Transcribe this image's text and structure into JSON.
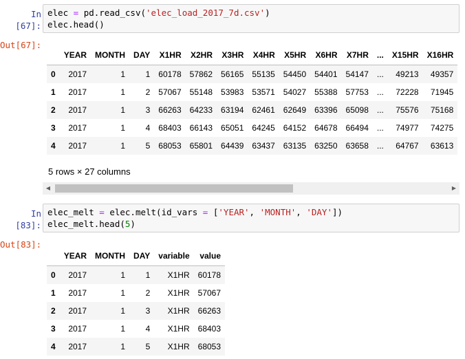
{
  "cell1": {
    "in_prompt": "In [67]:",
    "out_prompt": "Out[67]:",
    "code_line1_a": "elec ",
    "code_line1_op": "=",
    "code_line1_b": " pd.read_csv(",
    "code_line1_str": "'elec_load_2017_7d.csv'",
    "code_line1_c": ")",
    "code_line2": "elec.head()"
  },
  "df1": {
    "columns": [
      "",
      "YEAR",
      "MONTH",
      "DAY",
      "X1HR",
      "X2HR",
      "X3HR",
      "X4HR",
      "X5HR",
      "X6HR",
      "X7HR",
      "...",
      "X15HR",
      "X16HR"
    ],
    "rows": [
      [
        "0",
        "2017",
        "1",
        "1",
        "60178",
        "57862",
        "56165",
        "55135",
        "54450",
        "54401",
        "54147",
        "...",
        "49213",
        "49357"
      ],
      [
        "1",
        "2017",
        "1",
        "2",
        "57067",
        "55148",
        "53983",
        "53571",
        "54027",
        "55388",
        "57753",
        "...",
        "72228",
        "71945"
      ],
      [
        "2",
        "2017",
        "1",
        "3",
        "66263",
        "64233",
        "63194",
        "62461",
        "62649",
        "63396",
        "65098",
        "...",
        "75576",
        "75168"
      ],
      [
        "3",
        "2017",
        "1",
        "4",
        "68403",
        "66143",
        "65051",
        "64245",
        "64152",
        "64678",
        "66494",
        "...",
        "74977",
        "74275"
      ],
      [
        "4",
        "2017",
        "1",
        "5",
        "68053",
        "65801",
        "64439",
        "63437",
        "63135",
        "63250",
        "63658",
        "...",
        "64767",
        "63613"
      ]
    ],
    "shape_note": "5 rows × 27 columns"
  },
  "cell2": {
    "in_prompt": "In [83]:",
    "out_prompt": "Out[83]:",
    "code_line1_a": "elec_melt ",
    "code_line1_op": "=",
    "code_line1_b": " elec.melt(id_vars ",
    "code_line1_op2": "=",
    "code_line1_c": " [",
    "code_line1_s1": "'YEAR'",
    "code_line1_d": ", ",
    "code_line1_s2": "'MONTH'",
    "code_line1_e": ", ",
    "code_line1_s3": "'DAY'",
    "code_line1_f": "])",
    "code_line2_a": "elec_melt.head(",
    "code_line2_num": "5",
    "code_line2_b": ")"
  },
  "df2": {
    "columns": [
      "",
      "YEAR",
      "MONTH",
      "DAY",
      "variable",
      "value"
    ],
    "rows": [
      [
        "0",
        "2017",
        "1",
        "1",
        "X1HR",
        "60178"
      ],
      [
        "1",
        "2017",
        "1",
        "2",
        "X1HR",
        "57067"
      ],
      [
        "2",
        "2017",
        "1",
        "3",
        "X1HR",
        "66263"
      ],
      [
        "3",
        "2017",
        "1",
        "4",
        "X1HR",
        "68403"
      ],
      [
        "4",
        "2017",
        "1",
        "5",
        "X1HR",
        "68053"
      ]
    ]
  },
  "colors": {
    "in_prompt": "#303f9f",
    "out_prompt": "#d84315",
    "string": "#ba2121",
    "number": "#008000"
  },
  "icons": {
    "scroll_left": "triangle-left-icon",
    "scroll_right": "triangle-right-icon"
  }
}
